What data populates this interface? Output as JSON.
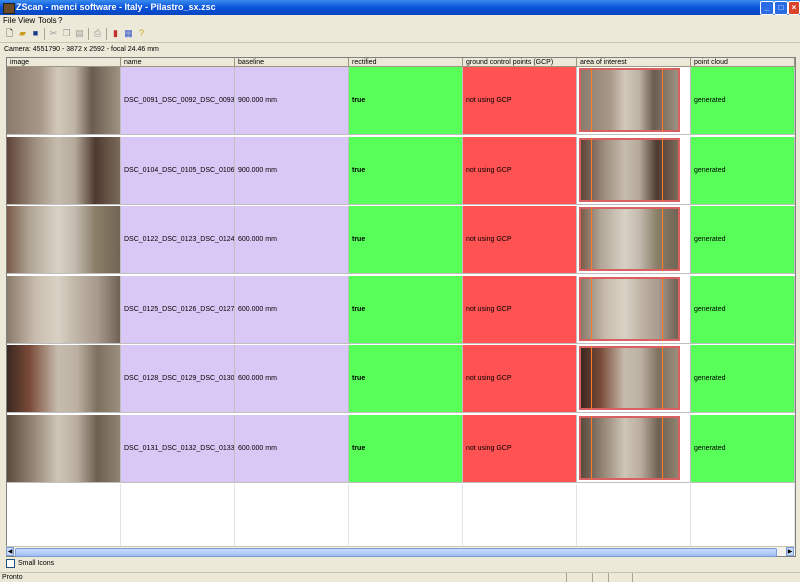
{
  "window": {
    "title": "ZScan - menci software - Italy - Pilastro_sx.zsc"
  },
  "menu": [
    "File",
    "View",
    "Tools",
    "?"
  ],
  "camera_info": "Camera:   4551790 - 3872 x 2592 - focal 24.46 mm",
  "columns": [
    "image",
    "name",
    "baseline",
    "rectified",
    "ground control points (GCP)",
    "area of interest",
    "point cloud"
  ],
  "colors": {
    "name": "#d9c8f5",
    "rectified": "#58ff58",
    "gcp": "#ff5252",
    "cloud": "#58ff58",
    "aoi": "#d86060"
  },
  "rows": [
    {
      "name": "DSC_0091_DSC_0092_DSC_0093",
      "baseline": "900.000 mm",
      "rectified": "true",
      "gcp": "not using GCP",
      "cloud": "generated"
    },
    {
      "name": "DSC_0104_DSC_0105_DSC_0106",
      "baseline": "900.000 mm",
      "rectified": "true",
      "gcp": "not using GCP",
      "cloud": "generated"
    },
    {
      "name": "DSC_0122_DSC_0123_DSC_0124",
      "baseline": "600.000 mm",
      "rectified": "true",
      "gcp": "not using GCP",
      "cloud": "generated"
    },
    {
      "name": "DSC_0125_DSC_0126_DSC_0127",
      "baseline": "600.000 mm",
      "rectified": "true",
      "gcp": "not using GCP",
      "cloud": "generated"
    },
    {
      "name": "DSC_0128_DSC_0129_DSC_0130",
      "baseline": "600.000 mm",
      "rectified": "true",
      "gcp": "not using GCP",
      "cloud": "generated"
    },
    {
      "name": "DSC_0131_DSC_0132_DSC_0133",
      "baseline": "600.000 mm",
      "rectified": "true",
      "gcp": "not using GCP",
      "cloud": "generated"
    }
  ],
  "options": {
    "small_icons_label": "Small Icons",
    "small_icons_checked": false
  },
  "status": {
    "text": "Pronto"
  }
}
